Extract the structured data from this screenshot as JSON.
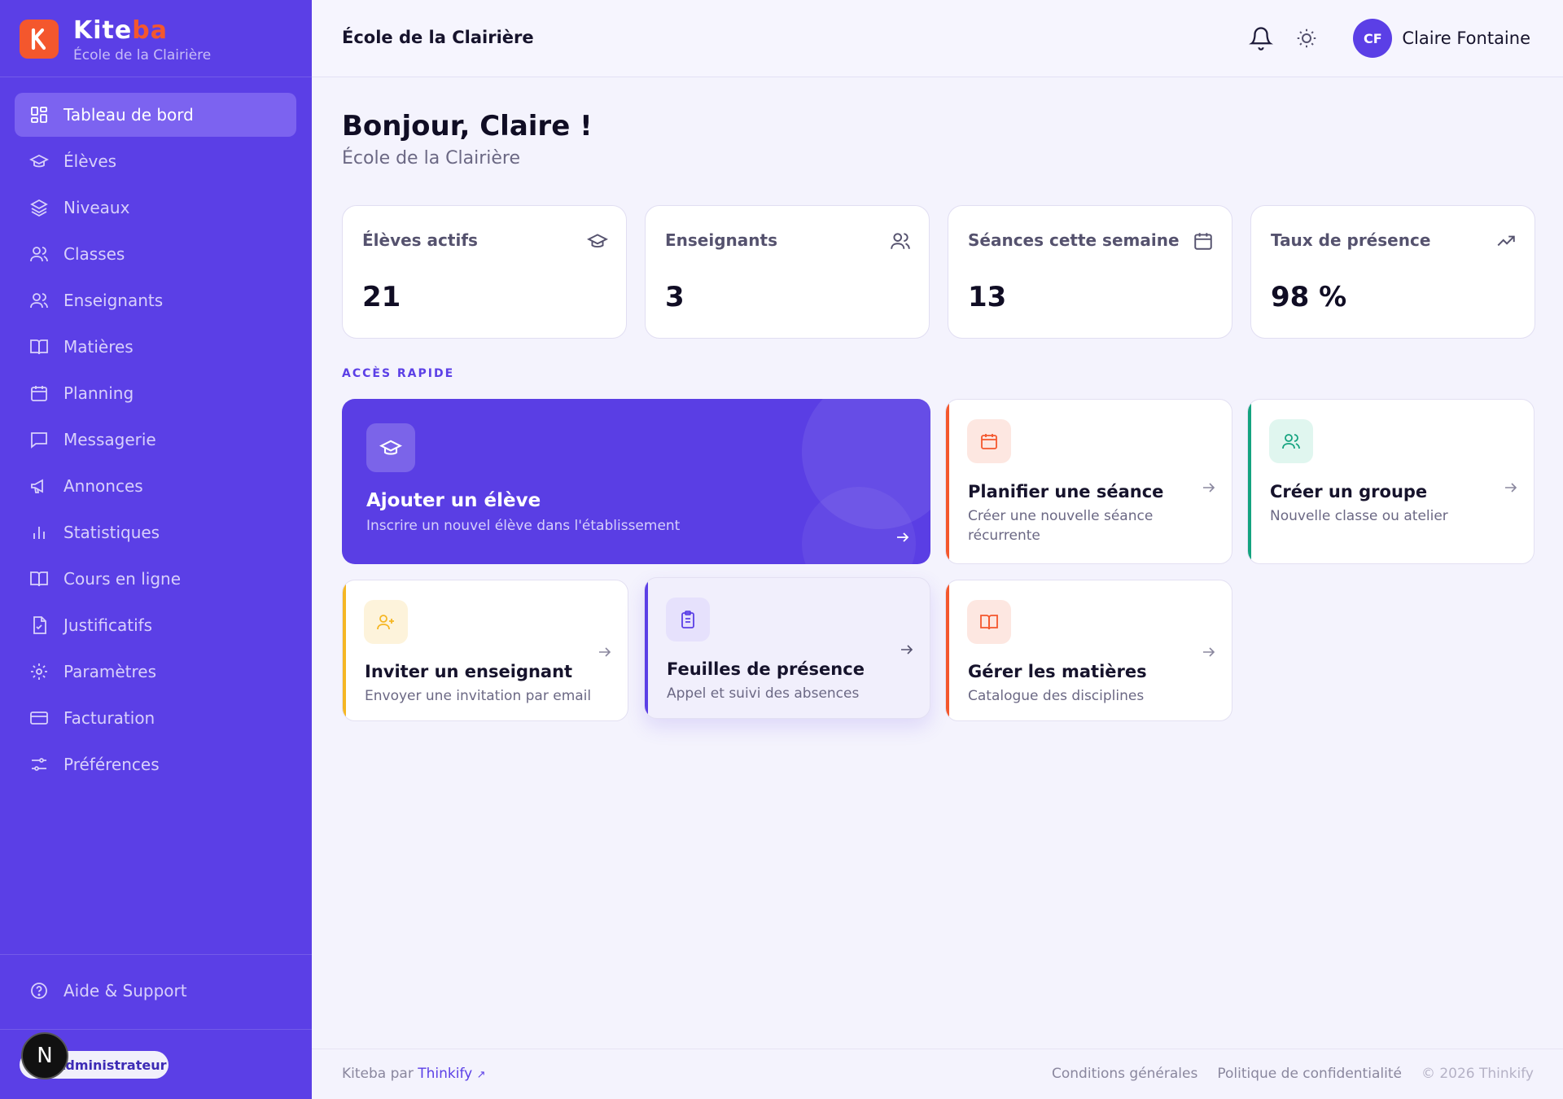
{
  "brand": {
    "name_part1": "Kite",
    "name_part2": "ba",
    "subtitle": "École de la Clairière",
    "logo_letter": "K"
  },
  "sidebar": {
    "items": [
      {
        "label": "Tableau de bord",
        "icon": "dashboard-icon",
        "active": true
      },
      {
        "label": "Élèves",
        "icon": "graduation-cap-icon"
      },
      {
        "label": "Niveaux",
        "icon": "layers-icon"
      },
      {
        "label": "Classes",
        "icon": "users-icon"
      },
      {
        "label": "Enseignants",
        "icon": "users-icon"
      },
      {
        "label": "Matières",
        "icon": "book-open-icon"
      },
      {
        "label": "Planning",
        "icon": "calendar-icon"
      },
      {
        "label": "Messagerie",
        "icon": "message-icon"
      },
      {
        "label": "Annonces",
        "icon": "megaphone-icon"
      },
      {
        "label": "Statistiques",
        "icon": "bar-chart-icon"
      },
      {
        "label": "Cours en ligne",
        "icon": "book-open-icon"
      },
      {
        "label": "Justificatifs",
        "icon": "file-check-icon"
      },
      {
        "label": "Paramètres",
        "icon": "gear-icon"
      },
      {
        "label": "Facturation",
        "icon": "credit-card-icon"
      },
      {
        "label": "Préférences",
        "icon": "sliders-icon"
      }
    ],
    "help": "Aide & Support",
    "role": "Administrateur",
    "badge": "N"
  },
  "header": {
    "title": "École de la Clairière",
    "avatar_initials": "CF",
    "user_name": "Claire Fontaine"
  },
  "main": {
    "greeting": "Bonjour, Claire !",
    "school": "École de la Clairière",
    "stats": [
      {
        "label": "Élèves actifs",
        "value": "21",
        "icon": "graduation-cap-icon"
      },
      {
        "label": "Enseignants",
        "value": "3",
        "icon": "users-icon"
      },
      {
        "label": "Séances cette semaine",
        "value": "13",
        "icon": "calendar-icon"
      },
      {
        "label": "Taux de présence",
        "value": "98 %",
        "icon": "trending-up-icon"
      }
    ],
    "quick_title": "ACCÈS RAPIDE",
    "quick": [
      {
        "title": "Ajouter un élève",
        "desc": "Inscrire un nouvel élève dans l'établissement",
        "icon": "graduation-cap-icon"
      },
      {
        "title": "Planifier une séance",
        "desc": "Créer une nouvelle séance récurrente",
        "icon": "calendar-icon",
        "accent": "#f4572d"
      },
      {
        "title": "Créer un groupe",
        "desc": "Nouvelle classe ou atelier",
        "icon": "users-icon",
        "accent": "#14a37f"
      },
      {
        "title": "Inviter un enseignant",
        "desc": "Envoyer une invitation par email",
        "icon": "user-plus-icon",
        "accent": "#f5b623"
      },
      {
        "title": "Feuilles de présence",
        "desc": "Appel et suivi des absences",
        "icon": "clipboard-icon",
        "accent": "#5b3fe6"
      },
      {
        "title": "Gérer les matières",
        "desc": "Catalogue des disciplines",
        "icon": "book-open-icon",
        "accent": "#f4572d"
      }
    ]
  },
  "footer": {
    "left_prefix": "Kiteba par",
    "left_link": "Thinkify",
    "terms": "Conditions générales",
    "privacy": "Politique de confidentialité",
    "copyright": "© 2026 Thinkify"
  },
  "colors": {
    "primary": "#5b3fe6",
    "accent_orange": "#f4572d",
    "accent_green": "#14a37f",
    "accent_yellow": "#f5b623"
  }
}
